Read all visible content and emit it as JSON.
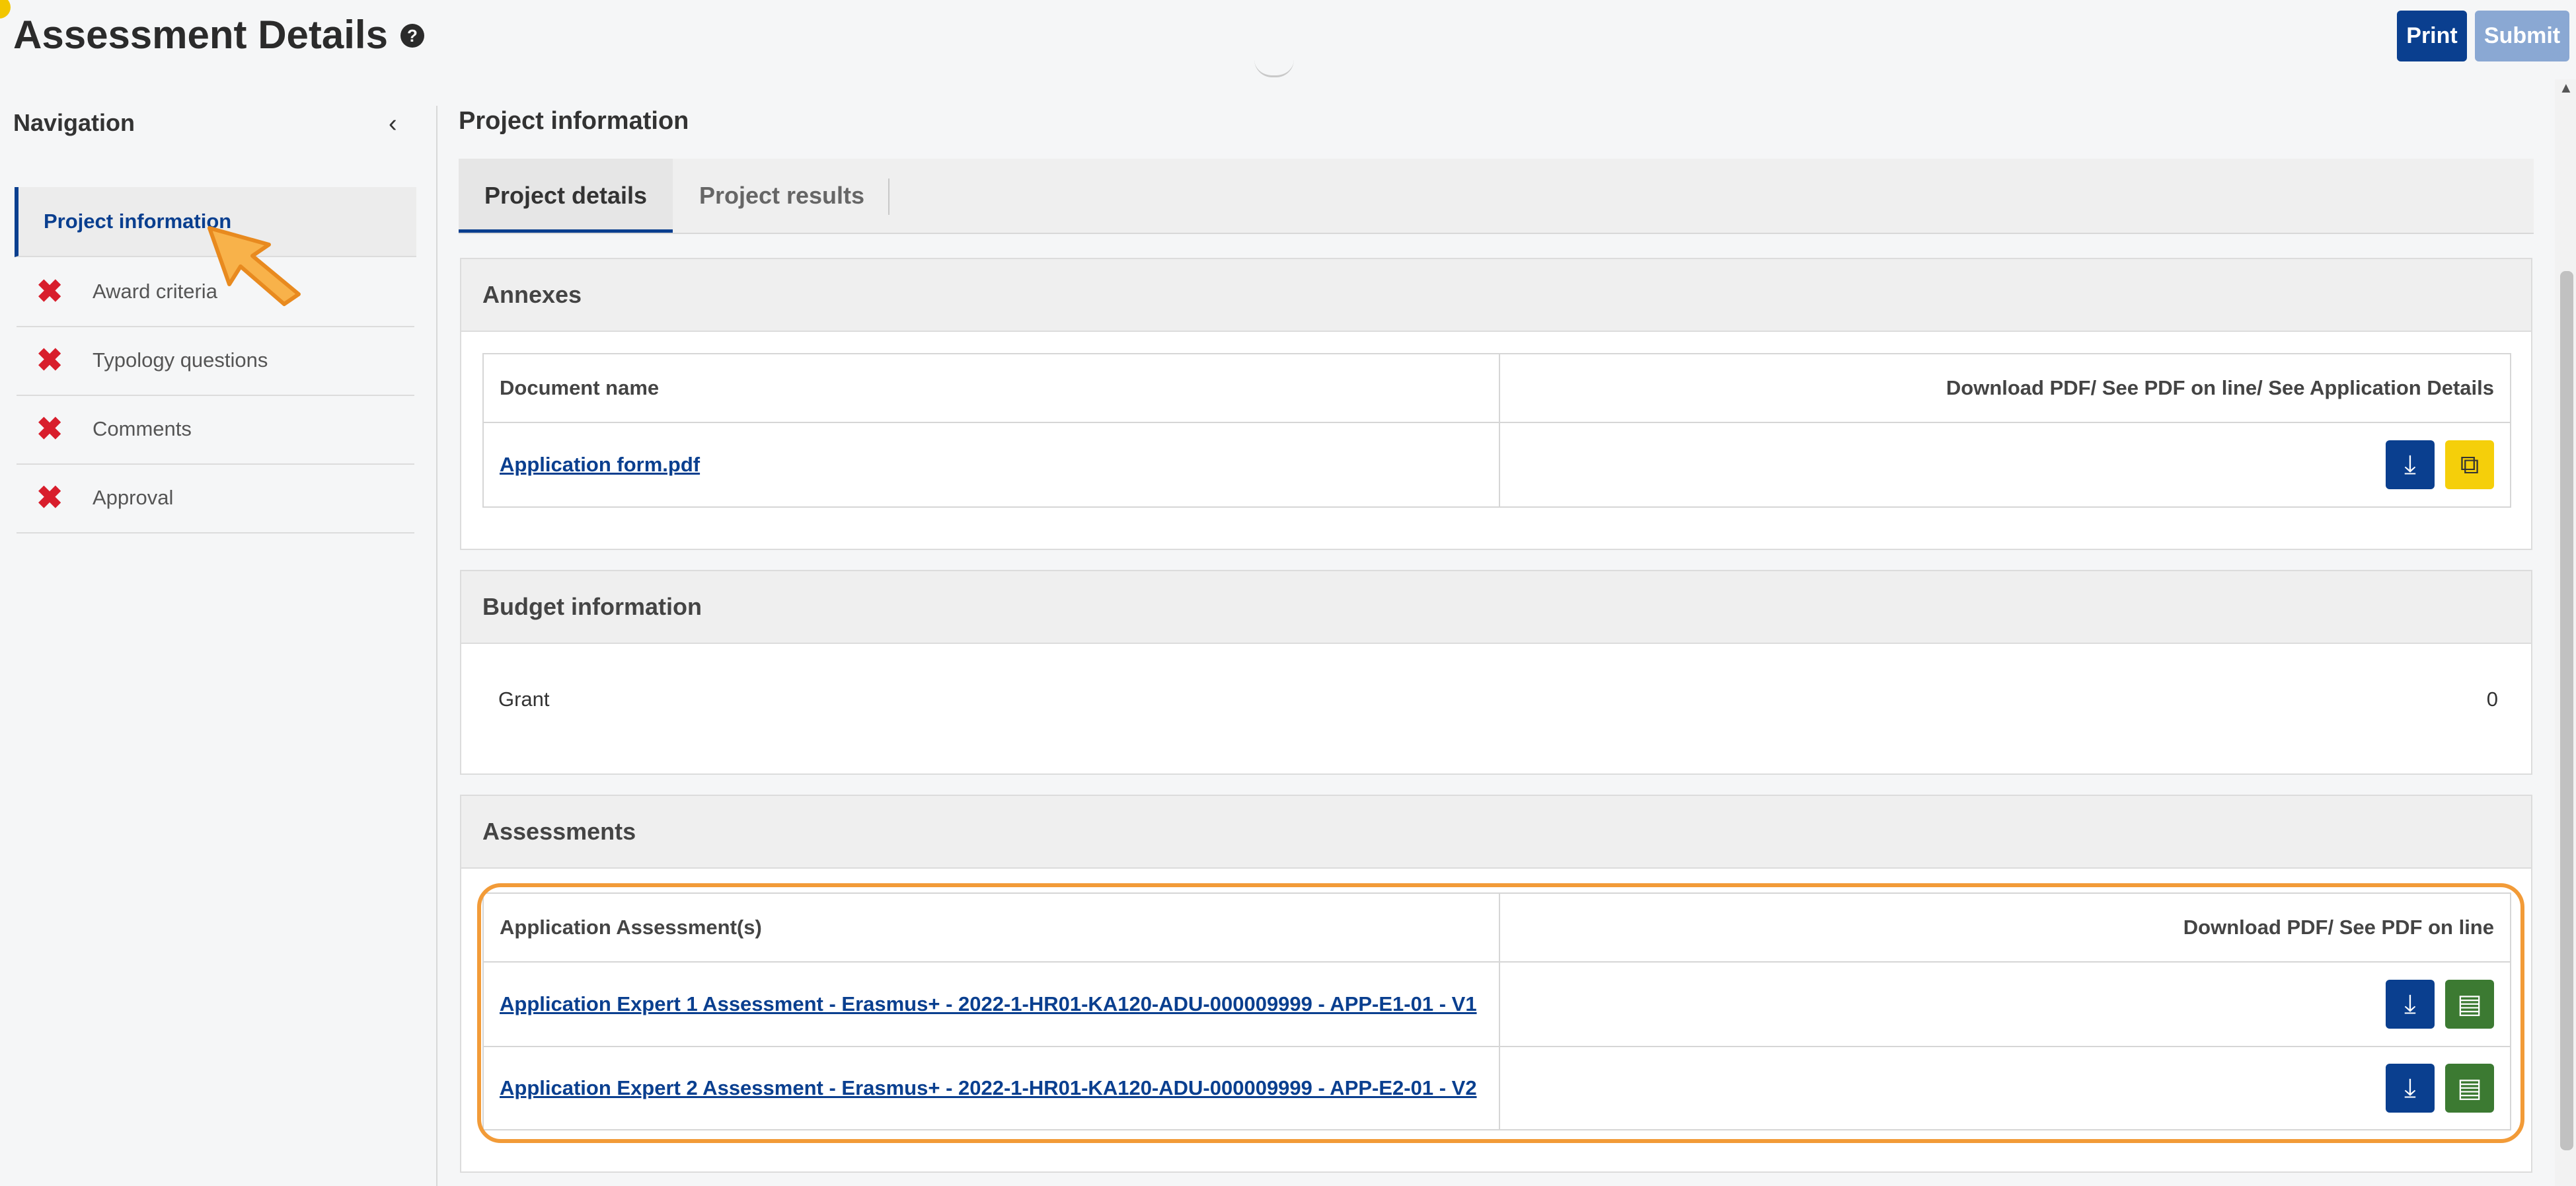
{
  "header": {
    "title": "Assessment Details",
    "help_icon": "?",
    "print_label": "Print",
    "submit_label": "Submit"
  },
  "sidebar": {
    "title": "Navigation",
    "collapse_icon": "‹",
    "items": [
      {
        "label": "Project information",
        "active": true,
        "status_icon": ""
      },
      {
        "label": "Award criteria",
        "active": false,
        "status_icon": "✖"
      },
      {
        "label": "Typology questions",
        "active": false,
        "status_icon": "✖"
      },
      {
        "label": "Comments",
        "active": false,
        "status_icon": "✖"
      },
      {
        "label": "Approval",
        "active": false,
        "status_icon": "✖"
      }
    ]
  },
  "main": {
    "section_title": "Project information",
    "tabs": [
      {
        "label": "Project details",
        "active": true
      },
      {
        "label": "Project results",
        "active": false
      }
    ],
    "annexes": {
      "title": "Annexes",
      "col1": "Document name",
      "col2": "Download PDF/ See PDF on line/ See Application Details",
      "rows": [
        {
          "name": "Application form.pdf"
        }
      ]
    },
    "budget": {
      "title": "Budget information",
      "label": "Grant",
      "value": "0"
    },
    "assessments": {
      "title": "Assessments",
      "col1": "Application Assessment(s)",
      "col2": "Download PDF/ See PDF on line",
      "rows": [
        {
          "name": "Application Expert 1 Assessment - Erasmus+ - 2022-1-HR01-KA120-ADU-000009999 - APP-E1-01 - V1"
        },
        {
          "name": "Application Expert 2 Assessment - Erasmus+ - 2022-1-HR01-KA120-ADU-000009999 - APP-E2-01 - V2"
        }
      ]
    }
  },
  "icons": {
    "download": "download-icon",
    "external": "external-link-icon",
    "pdf": "pdf-icon",
    "status_fail": "x-icon"
  },
  "colors": {
    "primary": "#0a3f8f",
    "accent_yellow": "#f5cf0a",
    "pdf_green": "#3c7a32",
    "error_red": "#d81e2c",
    "highlight_orange": "#f29b38"
  }
}
